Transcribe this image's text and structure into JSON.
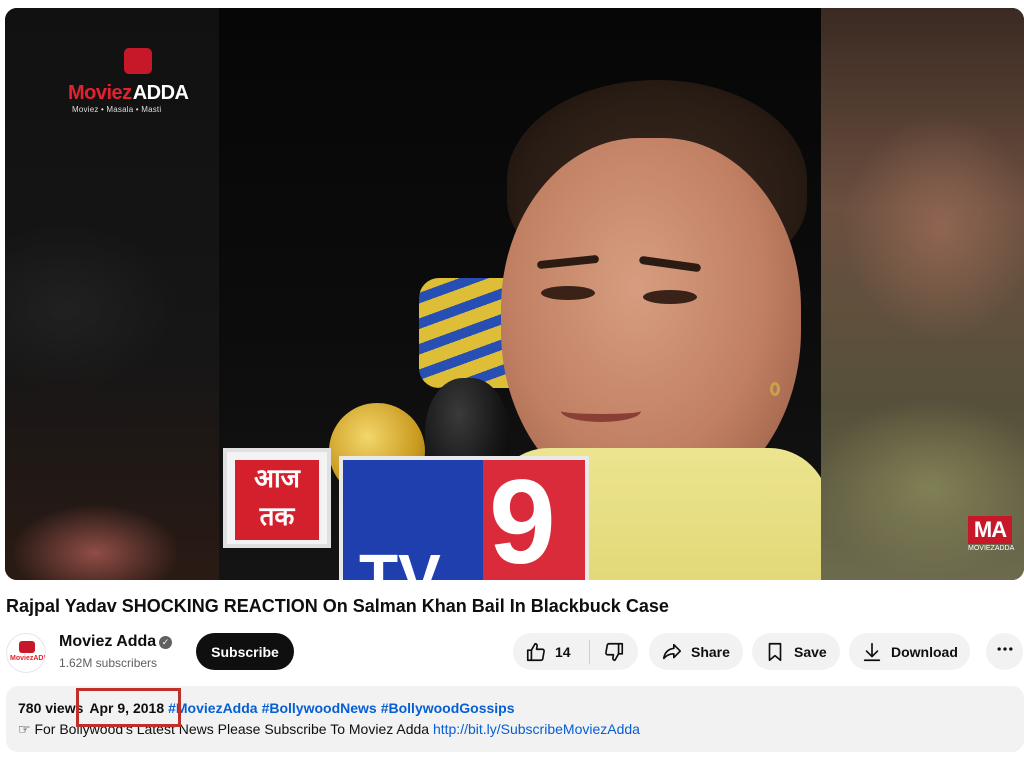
{
  "video": {
    "logo_top_left": "MoviezADDA",
    "logo_top_left_tagline": "Moviez • Masala • Masti",
    "logo_bottom_right": "MA",
    "logo_bottom_right_sub": "MOVIEZADDA",
    "mic_cube_1": "आज तक",
    "mic_cube_2": "TV9"
  },
  "title": "Rajpal Yadav SHOCKING REACTION On Salman Khan Bail In Blackbuck Case",
  "channel": {
    "name": "Moviez Adda",
    "subscribers": "1.62M subscribers",
    "subscribe_label": "Subscribe"
  },
  "actions": {
    "like_count": "14",
    "share_label": "Share",
    "save_label": "Save",
    "download_label": "Download"
  },
  "description": {
    "views": "780 views",
    "date": "Apr 9, 2018",
    "hashtags": [
      "#MoviezAdda",
      "#BollywoodNews",
      "#BollywoodGossips"
    ],
    "line_text": "☞ For Bollywood's Latest News Please Subscribe To Moviez Adda ",
    "link": "http://bit.ly/SubscribeMoviezAdda"
  },
  "colors": {
    "accent_red": "#c0302a",
    "link_blue": "#065fd4",
    "button_black": "#0f0f0f",
    "pill_gray": "#f2f2f2"
  }
}
